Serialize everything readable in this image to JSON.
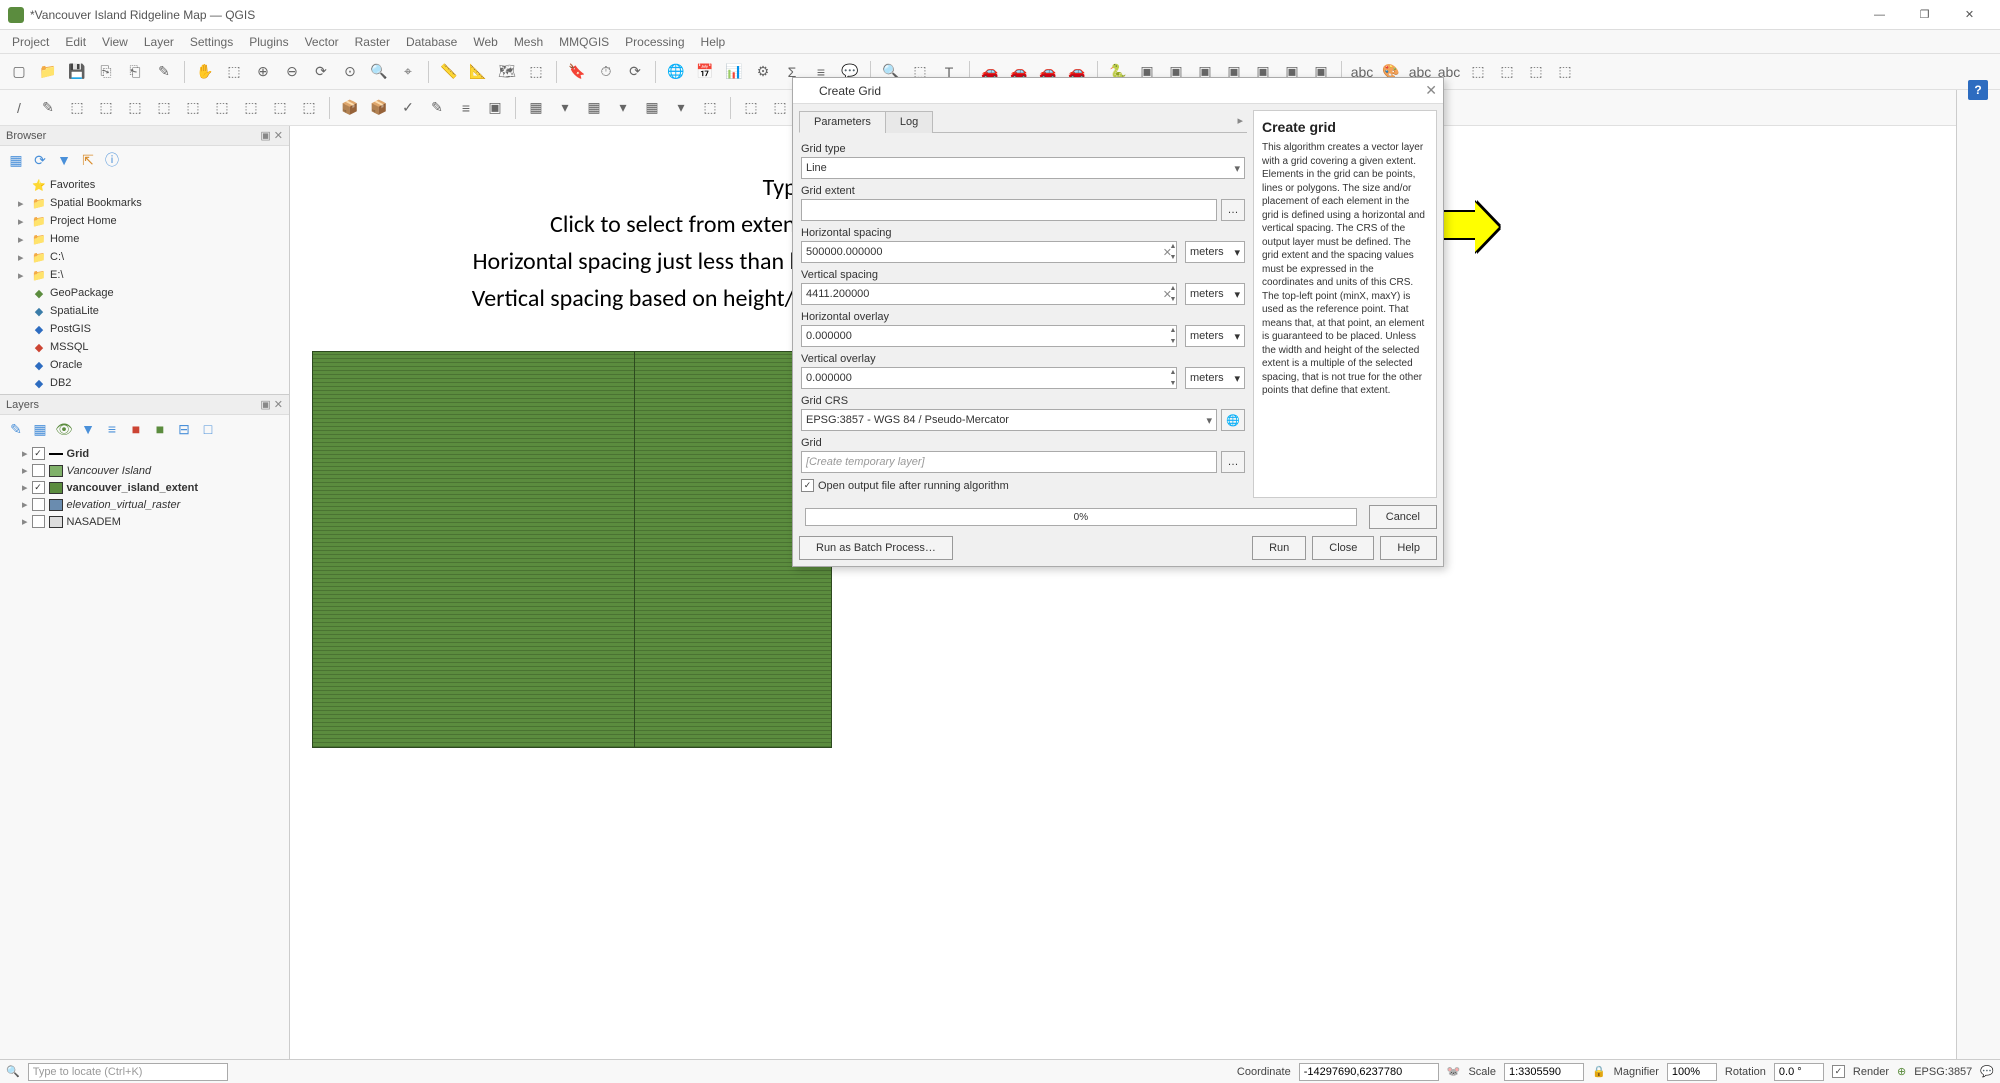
{
  "window": {
    "title": "*Vancouver Island Ridgeline Map — QGIS",
    "min": "—",
    "max": "❐",
    "close": "✕"
  },
  "menus": [
    "Project",
    "Edit",
    "View",
    "Layer",
    "Settings",
    "Plugins",
    "Vector",
    "Raster",
    "Database",
    "Web",
    "Mesh",
    "MMQGIS",
    "Processing",
    "Help"
  ],
  "browser": {
    "title": "Browser",
    "items": [
      {
        "icon": "⭐",
        "label": "Favorites",
        "color": "#e3a21a"
      },
      {
        "icon": "▸",
        "label": "Spatial Bookmarks"
      },
      {
        "icon": "▸",
        "label": "Project Home"
      },
      {
        "icon": "▸",
        "label": "Home"
      },
      {
        "icon": "▸",
        "label": "C:\\"
      },
      {
        "icon": "▸",
        "label": "E:\\"
      },
      {
        "icon": "◆",
        "label": "GeoPackage",
        "color": "#5b8c3e"
      },
      {
        "icon": "◆",
        "label": "SpatiaLite",
        "color": "#3a7ca8"
      },
      {
        "icon": "◆",
        "label": "PostGIS",
        "color": "#2d6cc0"
      },
      {
        "icon": "◆",
        "label": "MSSQL",
        "color": "#c43"
      },
      {
        "icon": "◆",
        "label": "Oracle",
        "color": "#2d6cc0"
      },
      {
        "icon": "◆",
        "label": "DB2",
        "color": "#2d6cc0"
      }
    ]
  },
  "layers": {
    "title": "Layers",
    "items": [
      {
        "checked": true,
        "swatch": "#000",
        "thin": true,
        "label": "Grid",
        "bold": true
      },
      {
        "checked": false,
        "swatch": "#7fb069",
        "label": "Vancouver Island",
        "italic": true
      },
      {
        "checked": true,
        "swatch": "#5b8c3e",
        "label": "vancouver_island_extent",
        "bold": true
      },
      {
        "checked": false,
        "swatch": "#6a8caf",
        "grid": true,
        "label": "elevation_virtual_raster",
        "italic": true
      },
      {
        "checked": false,
        "swatch": "#ddd",
        "label": "NASADEM"
      }
    ]
  },
  "annotations": {
    "a1": "Type should be Line",
    "a2": "Click to select from extent then select the Extent layer",
    "a3": "Horizontal spacing just less than horizontal extent",
    "a4": "Vertical spacing based on height/number of strips"
  },
  "dialog": {
    "title": "Create Grid",
    "tabs": {
      "parameters": "Parameters",
      "log": "Log"
    },
    "labels": {
      "grid_type": "Grid type",
      "grid_extent": "Grid extent",
      "hspacing": "Horizontal spacing",
      "vspacing": "Vertical spacing",
      "hoverlay": "Horizontal overlay",
      "voverlay": "Vertical overlay",
      "grid_crs": "Grid CRS",
      "grid": "Grid"
    },
    "values": {
      "grid_type": "Line",
      "grid_extent": "",
      "hspacing": "500000.000000",
      "vspacing": "4411.200000",
      "hoverlay": "0.000000",
      "voverlay": "0.000000",
      "grid_crs": "EPSG:3857 - WGS 84 / Pseudo-Mercator",
      "grid_placeholder": "[Create temporary layer]",
      "unit": "meters"
    },
    "checkbox": "Open output file after running algorithm",
    "progress": "0%",
    "buttons": {
      "batch": "Run as Batch Process…",
      "run": "Run",
      "close": "Close",
      "help": "Help",
      "cancel": "Cancel"
    },
    "help_title": "Create grid",
    "help_text": "This algorithm creates a vector layer with a grid covering a given extent. Elements in the grid can be points, lines or polygons. The size and/or placement of each element in the grid is defined using a horizontal and vertical spacing. The CRS of the output layer must be defined. The grid extent and the spacing values must be expressed in the coordinates and units of this CRS. The top-left point (minX, maxY) is used as the reference point. That means that, at that point, an element is guaranteed to be placed. Unless the width and height of the selected extent is a multiple of the selected spacing, that is not true for the other points that define that extent."
  },
  "status": {
    "locate": "Type to locate (Ctrl+K)",
    "coord_label": "Coordinate",
    "coord": "-14297690,6237780",
    "scale_label": "Scale",
    "scale": "1:3305590",
    "mag_label": "Magnifier",
    "mag": "100%",
    "rot_label": "Rotation",
    "rot": "0.0 °",
    "render": "Render",
    "epsg": "EPSG:3857"
  }
}
